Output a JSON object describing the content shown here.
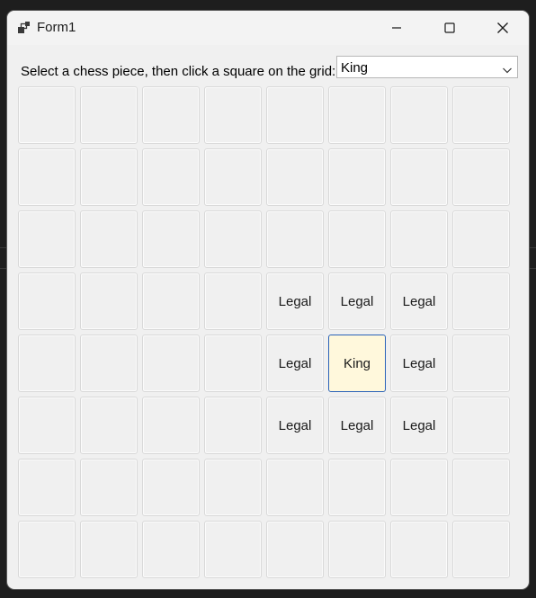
{
  "window": {
    "title": "Form1"
  },
  "titlebar_buttons": {
    "minimize": "minimize-icon",
    "maximize": "maximize-icon",
    "close": "close-icon"
  },
  "prompt": {
    "label": "Select a chess piece, then click a square on the grid:"
  },
  "piece_select": {
    "selected": "King"
  },
  "board": {
    "rows": [
      [
        "",
        "",
        "",
        "",
        "",
        "",
        "",
        ""
      ],
      [
        "",
        "",
        "",
        "",
        "",
        "",
        "",
        ""
      ],
      [
        "",
        "",
        "",
        "",
        "",
        "",
        "",
        ""
      ],
      [
        "",
        "",
        "",
        "",
        "Legal",
        "Legal",
        "Legal",
        ""
      ],
      [
        "",
        "",
        "",
        "",
        "Legal",
        "King",
        "Legal",
        ""
      ],
      [
        "",
        "",
        "",
        "",
        "Legal",
        "Legal",
        "Legal",
        ""
      ],
      [
        "",
        "",
        "",
        "",
        "",
        "",
        "",
        ""
      ],
      [
        "",
        "",
        "",
        "",
        "",
        "",
        "",
        ""
      ]
    ],
    "highlight_color": "#fff8dc",
    "focus_border_color": "#2a62b8"
  }
}
